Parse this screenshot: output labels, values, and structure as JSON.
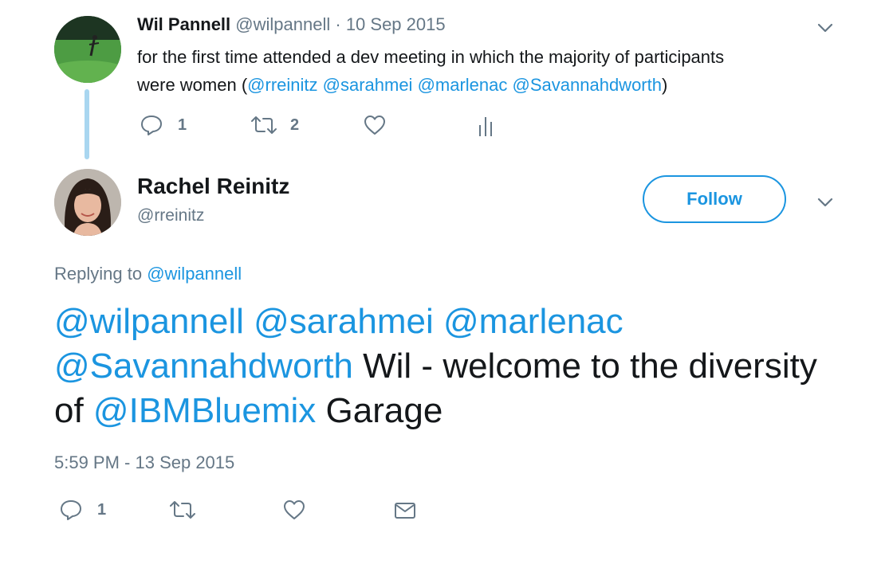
{
  "parent_tweet": {
    "author_name": "Wil Pannell",
    "handle": "@wilpannell",
    "separator": "·",
    "date": "10 Sep 2015",
    "text_line1": "for the first time attended a dev meeting in which the majority of participants",
    "text_line2_prefix": "were women (",
    "mentions": [
      "@rreinitz",
      "@sarahmei",
      "@marlenac",
      "@Savannahdworth"
    ],
    "text_line2_suffix": ")",
    "reply_count": "1",
    "retweet_count": "2",
    "icons": [
      "reply-icon",
      "retweet-icon",
      "like-icon",
      "analytics-icon",
      "chevron-down-icon"
    ]
  },
  "reply_tweet": {
    "author_name": "Rachel Reinitz",
    "handle": "@rreinitz",
    "follow_label": "Follow",
    "replying_to_label": "Replying to",
    "replying_to_handle": "@wilpannell",
    "mentions": [
      "@wilpannell",
      "@sarahmei",
      "@marlenac",
      "@Savannahdworth"
    ],
    "text_part1": " Wil - welcome to the diversity of ",
    "text_mention": "@IBMBluemix",
    "text_part2": " Garage",
    "timestamp": "5:59 PM - 13 Sep 2015",
    "reply_count": "1",
    "icons": [
      "reply-icon",
      "retweet-icon",
      "like-icon",
      "dm-envelope-icon",
      "chevron-down-icon"
    ]
  },
  "colors": {
    "link": "#1b95e0",
    "muted": "#657786",
    "text": "#14171a",
    "thread_line": "#a9d6f0"
  }
}
